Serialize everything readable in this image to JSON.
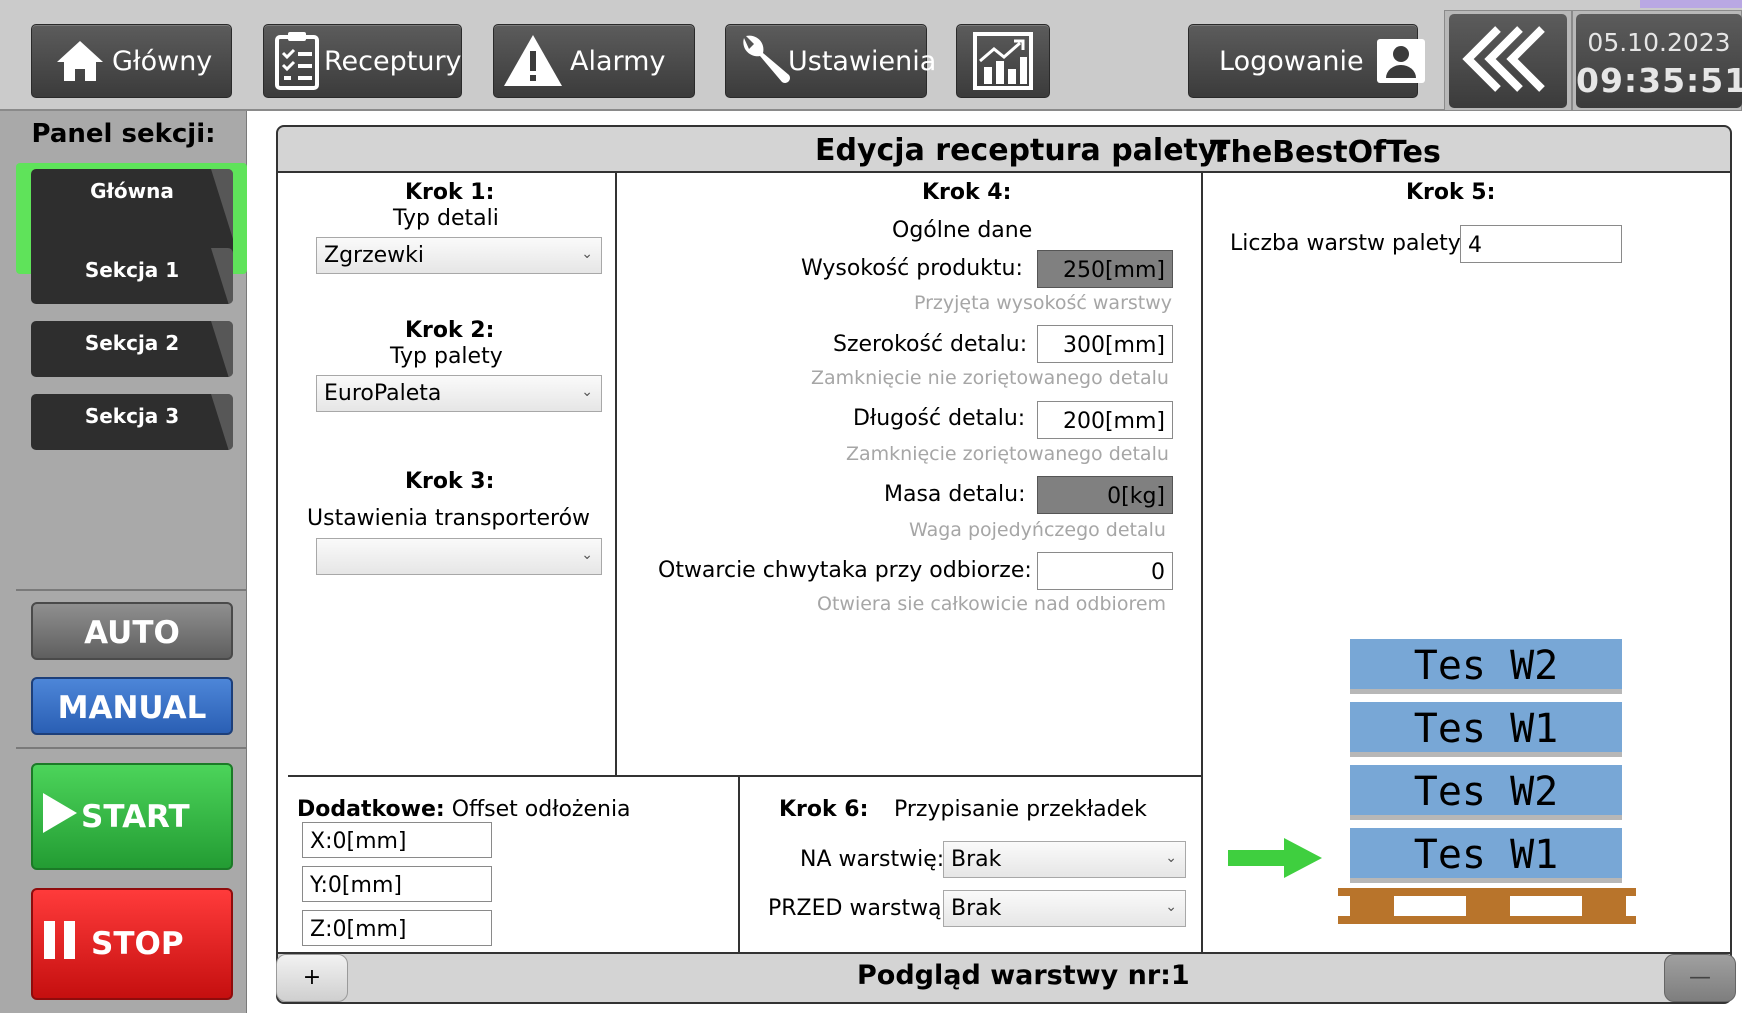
{
  "topbar": {
    "home_label": "Główny",
    "recipes_label": "Receptury",
    "alarms_label": "Alarmy",
    "settings_label": "Ustawienia",
    "login_label": "Logowanie",
    "date": "05.10.2023",
    "time": "09:35:51"
  },
  "left_panel": {
    "title": "Panel sekcji:",
    "sections": [
      "Główna",
      "Sekcja 1",
      "Sekcja 2",
      "Sekcja 3"
    ],
    "selected_section": "Główna",
    "auto_label": "AUTO",
    "manual_label": "MANUAL",
    "start_label": "START",
    "stop_label": "STOP"
  },
  "editor": {
    "title_label": "Edycja receptura palety:",
    "recipe_name": "TheBestOfTes",
    "step1": {
      "title": "Krok 1:",
      "subtitle": "Typ detali",
      "value": "Zgrzewki"
    },
    "step2": {
      "title": "Krok 2:",
      "subtitle": "Typ palety",
      "value": "EuroPaleta"
    },
    "step3": {
      "title": "Krok 3:",
      "subtitle": "Ustawienia transporterów",
      "value": ""
    },
    "step4": {
      "title": "Krok 4:",
      "subtitle": "Ogólne dane",
      "product_height_label": "Wysokość produktu:",
      "product_height_value": "250[mm]",
      "product_height_hint": "Przyjęta wysokość warstwy",
      "width_label": "Szerokość detalu:",
      "width_value": "300[mm]",
      "width_hint": "Zamknięcie nie zoriętowanego detalu",
      "length_label": "Długość detalu:",
      "length_value": "200[mm]",
      "length_hint": "Zamknięcie zoriętowanego detalu",
      "mass_label": "Masa detalu:",
      "mass_value": "0[kg]",
      "mass_hint": "Waga pojedyńczego detalu",
      "gripper_label": "Otwarcie chwytaka przy odbiorze:",
      "gripper_value": "0",
      "gripper_hint": "Otwiera sie całkowicie nad odbiorem"
    },
    "step5": {
      "title": "Krok 5:",
      "layers_label": "Liczba warstw palety:",
      "layers_value": "4"
    },
    "extra": {
      "title_bold": "Dodatkowe:",
      "title_rest": "Offset odłożenia",
      "x": "X:0[mm]",
      "y": "Y:0[mm]",
      "z": "Z:0[mm]"
    },
    "step6": {
      "title": "Krok 6:",
      "subtitle": "Przypisanie przekładek",
      "on_layer_label": "NA warstwię:",
      "on_layer_value": "Brak",
      "before_layer_label": "PRZED warstwą:",
      "before_layer_value": "Brak"
    },
    "pallet_layers": [
      "Tes W2",
      "Tes W1",
      "Tes W2",
      "Tes W1"
    ],
    "preview_label": "Podgląd warstwy nr:1",
    "plus_label": "+",
    "minus_label": "—"
  },
  "colors": {
    "selected_frame": "#5fe35a",
    "manual": "#2a5fb4",
    "start": "#239c33",
    "stop": "#c50f0f",
    "layer": "#78a7d6",
    "pallet_wood": "#b8742b",
    "arrow": "#3fcf3f"
  }
}
